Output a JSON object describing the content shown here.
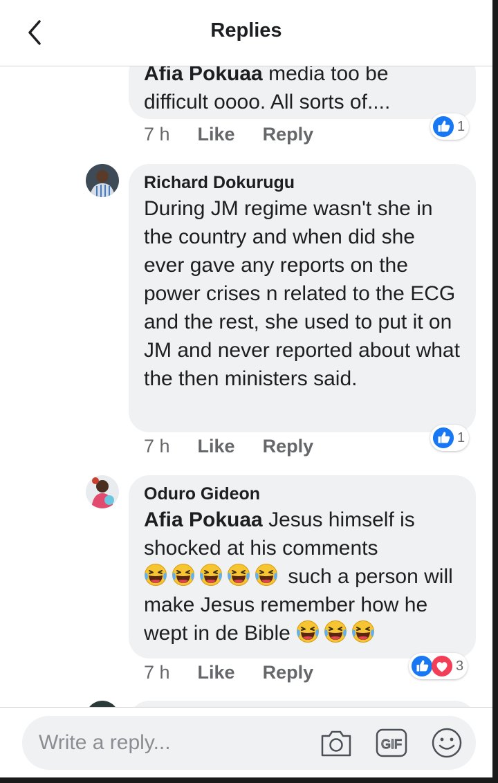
{
  "header": {
    "title": "Replies"
  },
  "comments": [
    {
      "author": "Afia Pokuaa",
      "text_lead": "media too be",
      "text": "difficult oooo. All sorts of....",
      "time": "7 h",
      "like_label": "Like",
      "reply_label": "Reply",
      "reaction_count": "1"
    },
    {
      "author": "Richard Dokurugu",
      "text": "During JM regime wasn't she in the country and when did she ever gave any reports on the power crises n related to the ECG and the rest, she used to put it on JM and never reported about what the then ministers said.",
      "time": "7 h",
      "like_label": "Like",
      "reply_label": "Reply",
      "reaction_count": "1"
    },
    {
      "author": "Oduro Gideon",
      "mention": "Afia Pokuaa",
      "text_1": "Jesus himself is shocked at his comments",
      "text_2": "such a person will make Jesus remember how he wept in de Bible",
      "time": "7 h",
      "like_label": "Like",
      "reply_label": "Reply",
      "reaction_count": "3"
    }
  ],
  "composer": {
    "placeholder": "Write a reply..."
  },
  "colors": {
    "like_blue": "#1877f2",
    "love_red": "#f33e58",
    "emoji_yellow": "#f7c531",
    "bubble_bg": "#eff1f3"
  },
  "icons": [
    "back-arrow-icon",
    "like-icon",
    "love-icon",
    "laughing-emoji-icon",
    "camera-icon",
    "gif-icon",
    "smiley-icon"
  ]
}
